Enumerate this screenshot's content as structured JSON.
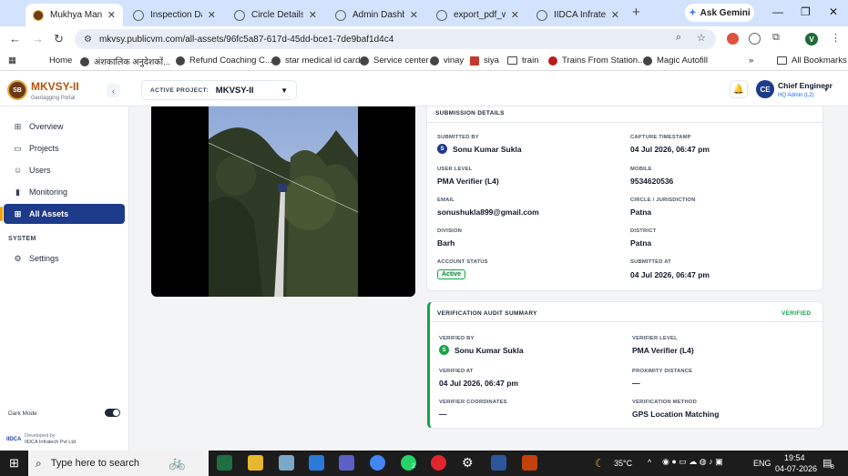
{
  "browser": {
    "tabs": [
      {
        "title": "Mukhya Mantri K",
        "active": true
      },
      {
        "title": "Inspection Data E"
      },
      {
        "title": "Circle Details"
      },
      {
        "title": "Admin Dashboar"
      },
      {
        "title": "export_pdf_waive"
      },
      {
        "title": "IIDCA Infratech P"
      }
    ],
    "gemini_label": "Ask Gemini",
    "url": "mkvsy.publicvm.com/all-assets/96fc5a87-617d-45dd-bce1-7de9baf1d4c4",
    "profile_initial": "V",
    "bookmarks": [
      "Home",
      "अंशकालिक अनुदेशकों...",
      "Refund Coaching C...",
      "star medical id card",
      "Service center",
      "vinay",
      "siya",
      "train",
      "Trains From Station...",
      "Magic Autofill"
    ],
    "all_bookmarks": "All Bookmarks"
  },
  "app": {
    "logo_text": "SB",
    "brand": "MKVSY-II",
    "brand_sub": "Geotagging Portal",
    "active_project_label": "ACTIVE PROJECT:",
    "active_project": "MKVSY-II",
    "user_initials": "CE",
    "user_name": "Chief Engineer",
    "user_role": "HQ Admin (L2)"
  },
  "sidebar": {
    "items": [
      {
        "label": "Overview",
        "icon": "grid-icon"
      },
      {
        "label": "Projects",
        "icon": "folder-icon"
      },
      {
        "label": "Users",
        "icon": "users-icon"
      },
      {
        "label": "Monitoring",
        "icon": "chart-icon"
      },
      {
        "label": "All Assets",
        "icon": "grid-icon",
        "active": true
      }
    ],
    "system_label": "SYSTEM",
    "settings_label": "Settings",
    "dark_mode_label": "Dark Mode",
    "developed_by": "Developed by",
    "developer": "IIDCA Infratech Pvt Ltd",
    "developer_logo": "IIDCA"
  },
  "submission": {
    "title": "SUBMISSION DETAILS",
    "submitted_by_label": "SUBMITTED BY",
    "submitted_by_initial": "S",
    "submitted_by": "Sonu Kumar Sukla",
    "capture_label": "CAPTURE TIMESTAMP",
    "capture": "04 Jul 2026, 06:47 pm",
    "user_level_label": "USER LEVEL",
    "user_level": "PMA Verifier (L4)",
    "mobile_label": "MOBILE",
    "mobile": "9534620536",
    "email_label": "EMAIL",
    "email": "sonushukla899@gmail.com",
    "circle_label": "CIRCLE / JURISDICTION",
    "circle": "Patna",
    "division_label": "DIVISION",
    "division": "Barh",
    "district_label": "DISTRICT",
    "district": "Patna",
    "account_status_label": "ACCOUNT STATUS",
    "account_status": "Active",
    "submitted_at_label": "SUBMITTED AT",
    "submitted_at": "04 Jul 2026, 06:47 pm"
  },
  "verification": {
    "title": "VERIFICATION AUDIT SUMMARY",
    "status": "VERIFIED",
    "verified_by_label": "VERIFIED BY",
    "verified_by_initial": "S",
    "verified_by": "Sonu Kumar Sukla",
    "verifier_level_label": "VERIFIER LEVEL",
    "verifier_level": "PMA Verifier (L4)",
    "verified_at_label": "VERIFIED AT",
    "verified_at": "04 Jul 2026, 06:47 pm",
    "proximity_label": "PROXIMITY DISTANCE",
    "proximity": "—",
    "coords_label": "VERIFIER COORDINATES",
    "coords": "—",
    "method_label": "VERIFICATION METHOD",
    "method": "GPS Location Matching"
  },
  "taskbar": {
    "search_placeholder": "Type here to search",
    "weather": "35°C",
    "lang": "ENG",
    "time": "19:54",
    "date": "04-07-2026",
    "notifications": "8",
    "whatsapp_badge": "2"
  }
}
